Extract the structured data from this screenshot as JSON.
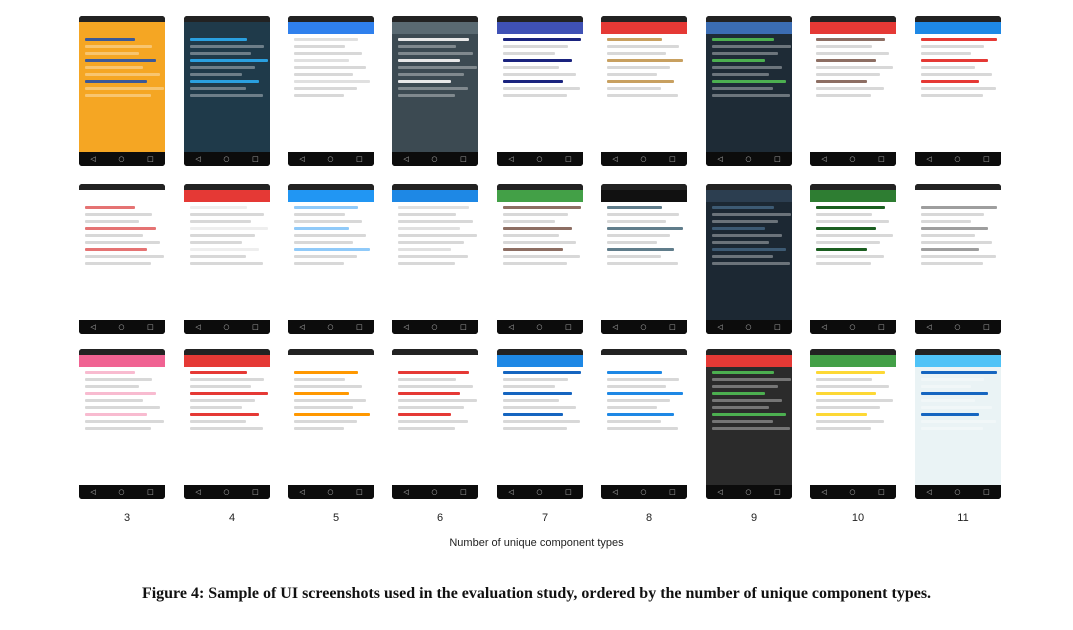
{
  "figure": {
    "caption": "Figure 4: Sample of UI screenshots used in the evaluation study, ordered by the number of unique component types.",
    "axis_title": "Number of unique component types",
    "column_labels": [
      "3",
      "4",
      "5",
      "6",
      "7",
      "8",
      "9",
      "10",
      "11"
    ],
    "nav_glyphs": [
      "◁",
      "○",
      "□"
    ]
  },
  "rows": [
    [
      {
        "name": "onboarding-sign-in",
        "bg": "#f5a623",
        "bar": "#f5a623",
        "accent": "#3b5998"
      },
      {
        "name": "passcode-lock",
        "bg": "#1f3a4a",
        "bar": "#1f3a4a",
        "accent": "#2aa0e0"
      },
      {
        "name": "form-settings",
        "bg": "#ffffff",
        "bar": "#2f80ed",
        "accent": "#e0e0e0"
      },
      {
        "name": "planning-text",
        "bg": "#3c4a52",
        "bar": "#5a6a72",
        "accent": "#e8e8e8"
      },
      {
        "name": "app-store-list",
        "bg": "#ffffff",
        "bar": "#3f51b5",
        "accent": "#1a237e"
      },
      {
        "name": "recipe-grid",
        "bg": "#ffffff",
        "bar": "#e53935",
        "accent": "#c8a060"
      },
      {
        "name": "budget-transactions",
        "bg": "#1e2b36",
        "bar": "#3b6db3",
        "accent": "#4caf50"
      },
      {
        "name": "photo-picker",
        "bg": "#ffffff",
        "bar": "#e53935",
        "accent": "#8d6e63"
      },
      {
        "name": "route-planner",
        "bg": "#ffffff",
        "bar": "#1e88e5",
        "accent": "#e53935"
      }
    ],
    [
      {
        "name": "recipe-detail",
        "bg": "#ffffff",
        "bar": "#ffffff",
        "accent": "#e57373"
      },
      {
        "name": "settings-menu",
        "bg": "#ffffff",
        "bar": "#e53935",
        "accent": "#eeeeee"
      },
      {
        "name": "safety-plan",
        "bg": "#ffffff",
        "bar": "#2196f3",
        "accent": "#90caf9"
      },
      {
        "name": "food-list",
        "bg": "#ffffff",
        "bar": "#1e88e5",
        "accent": "#e0e0e0"
      },
      {
        "name": "auto-news-list",
        "bg": "#ffffff",
        "bar": "#43a047",
        "accent": "#8d6e63"
      },
      {
        "name": "news-feed",
        "bg": "#ffffff",
        "bar": "#111111",
        "accent": "#607d8b"
      },
      {
        "name": "radio-stations",
        "bg": "#1c2833",
        "bar": "#2c3e50",
        "accent": "#3d5a73"
      },
      {
        "name": "bank-menu",
        "bg": "#ffffff",
        "bar": "#2e7d32",
        "accent": "#1b5e20"
      },
      {
        "name": "filter-form",
        "bg": "#ffffff",
        "bar": "#ffffff",
        "accent": "#9e9e9e"
      }
    ],
    [
      {
        "name": "timer-ring",
        "bg": "#ffffff",
        "bar": "#f06292",
        "accent": "#f8bbd0"
      },
      {
        "name": "contact-card",
        "bg": "#ffffff",
        "bar": "#e53935",
        "accent": "#e53935"
      },
      {
        "name": "play-store-app",
        "bg": "#ffffff",
        "bar": "#ffffff",
        "accent": "#ff9800"
      },
      {
        "name": "offline-page",
        "bg": "#ffffff",
        "bar": "#ffffff",
        "accent": "#e53935"
      },
      {
        "name": "messaging-menu",
        "bg": "#ffffff",
        "bar": "#1e88e5",
        "accent": "#1565c0"
      },
      {
        "name": "dialer-keypad",
        "bg": "#ffffff",
        "bar": "#ffffff",
        "accent": "#1e88e5"
      },
      {
        "name": "audio-recorder",
        "bg": "#2b2b2b",
        "bar": "#e53935",
        "accent": "#4caf50"
      },
      {
        "name": "event-form",
        "bg": "#ffffff",
        "bar": "#43a047",
        "accent": "#fdd835"
      },
      {
        "name": "map-view",
        "bg": "#eaf3f5",
        "bar": "#4fc3f7",
        "accent": "#1565c0"
      }
    ]
  ]
}
